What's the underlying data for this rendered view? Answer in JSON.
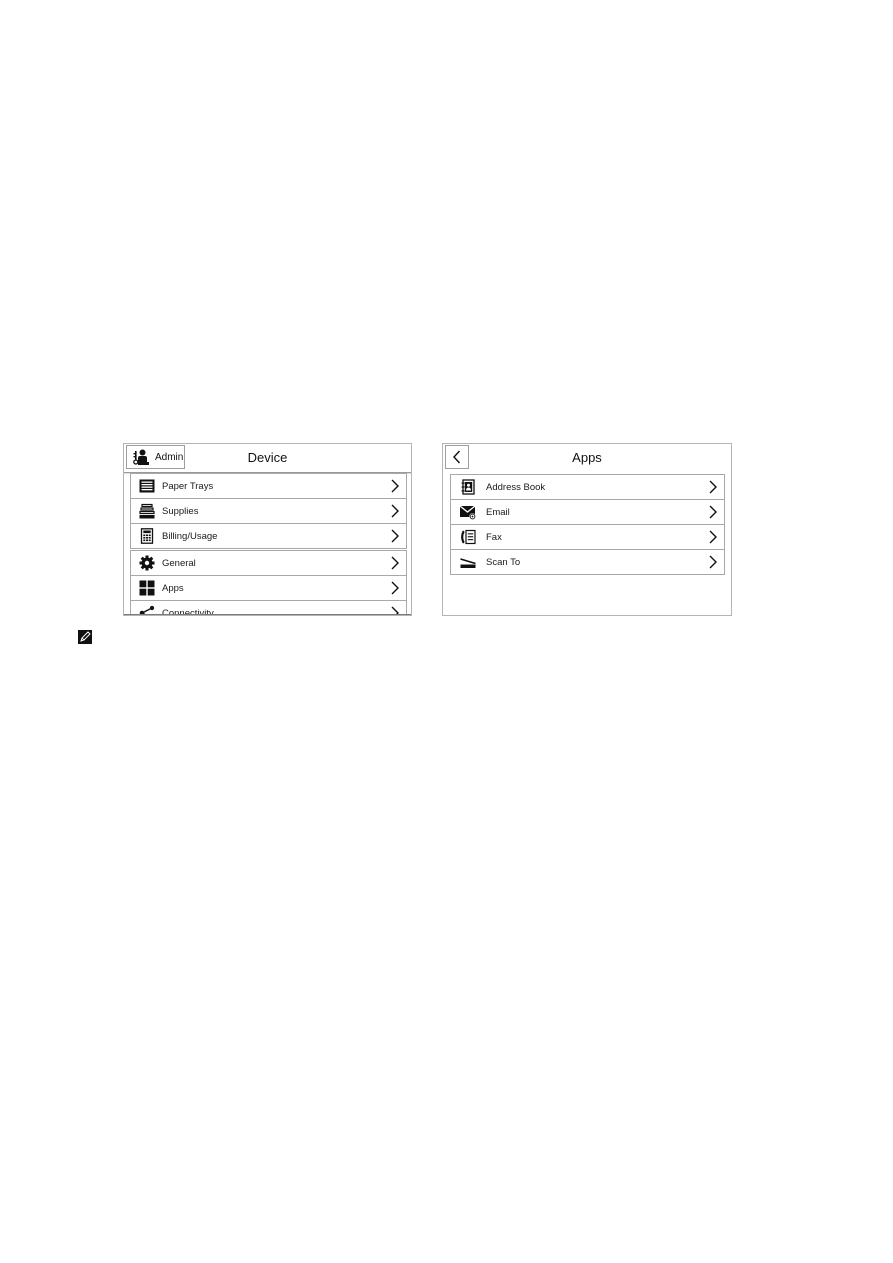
{
  "device_screen": {
    "header": {
      "title": "Device",
      "admin_button_label": "Admin",
      "admin_icon": "admin-user-key-icon"
    },
    "groups": [
      {
        "items": [
          {
            "label": "Paper Trays",
            "icon": "paper-trays-icon"
          },
          {
            "label": "Supplies",
            "icon": "supplies-icon"
          },
          {
            "label": "Billing/Usage",
            "icon": "calculator-icon"
          }
        ]
      },
      {
        "items": [
          {
            "label": "General",
            "icon": "gear-icon"
          },
          {
            "label": "Apps",
            "icon": "apps-grid-icon"
          },
          {
            "label": "Connectivity",
            "icon": "share-icon"
          }
        ]
      }
    ]
  },
  "apps_screen": {
    "header": {
      "title": "Apps",
      "back_icon": "chevron-left-icon"
    },
    "items": [
      {
        "label": "Address Book",
        "icon": "address-book-icon"
      },
      {
        "label": "Email",
        "icon": "email-icon"
      },
      {
        "label": "Fax",
        "icon": "fax-icon"
      },
      {
        "label": "Scan To",
        "icon": "scanner-icon"
      }
    ]
  },
  "note": {
    "icon": "note-pencil-icon"
  }
}
